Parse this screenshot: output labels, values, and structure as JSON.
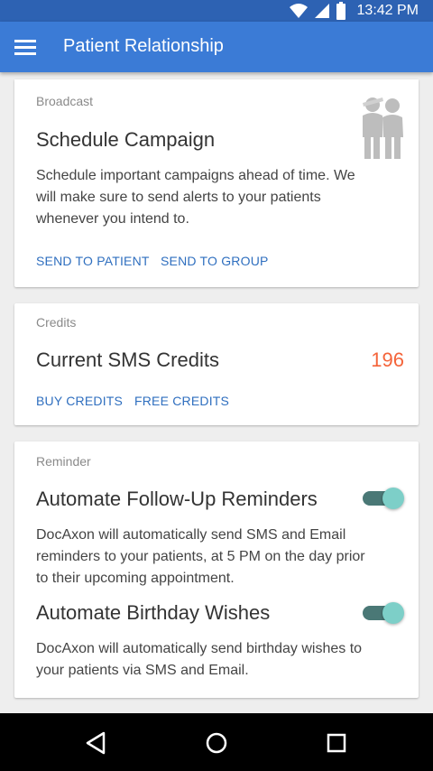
{
  "status_bar": {
    "time": "13:42 PM"
  },
  "app_bar": {
    "title": "Patient Relationship"
  },
  "broadcast_card": {
    "overline": "Broadcast",
    "title": "Schedule Campaign",
    "description": "Schedule important campaigns ahead of time. We will make sure to send alerts to your patients whenever you intend to.",
    "actions": [
      "SEND TO PATIENT",
      "SEND TO GROUP"
    ]
  },
  "credits_card": {
    "overline": "Credits",
    "title": "Current SMS Credits",
    "value": "196",
    "actions": [
      "BUY CREDITS",
      "FREE CREDITS"
    ]
  },
  "reminder_card": {
    "overline": "Reminder",
    "items": [
      {
        "title": "Automate Follow-Up Reminders",
        "description": "DocAxon will automatically send SMS and Email reminders to your patients, at 5 PM on the day prior to their upcoming appointment.",
        "enabled": true
      },
      {
        "title": "Automate Birthday Wishes",
        "description": "DocAxon will automatically send birthday wishes to your patients via SMS and Email.",
        "enabled": true
      }
    ]
  },
  "colors": {
    "primary": "#3b7bd6",
    "status_bar": "#2d62b3",
    "accent_text": "#2f6fbf",
    "credits_value": "#f4643a",
    "toggle_on": "#7dcfc8"
  },
  "icons": [
    "wifi-icon",
    "signal-icon",
    "battery-icon",
    "menu-icon",
    "back-icon",
    "home-icon",
    "recents-icon"
  ]
}
